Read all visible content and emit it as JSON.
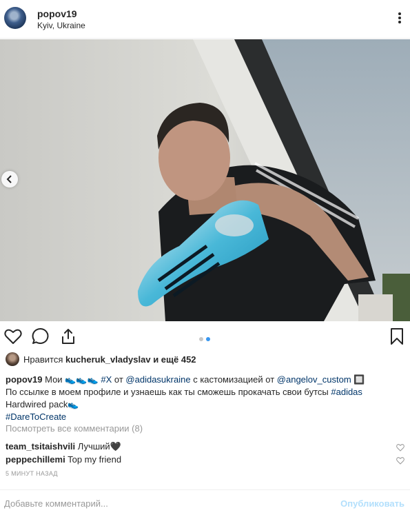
{
  "post": {
    "username": "popov19",
    "location": "Kyiv, Ukraine",
    "more_icon": "more-horizontal-icon"
  },
  "carousel": {
    "total": 2,
    "active_index": 1,
    "colors": {
      "active": "#3897f0",
      "inactive": "#c7c7c7"
    }
  },
  "actions": {
    "like_icon": "heart-outline-icon",
    "comment_icon": "comment-bubble-icon",
    "share_icon": "share-upload-icon",
    "save_icon": "bookmark-icon"
  },
  "likes": {
    "prefix": "Нравится",
    "user": "kucheruk_vladyslav",
    "suffix": "и ещё 452"
  },
  "caption": {
    "author": "popov19",
    "t1": "Мои 👟👟👟",
    "hashtag_x": "#X",
    "t2": "от",
    "mention_adidas": "@adidasukraine",
    "t3": "с кастомизацией от",
    "mention_angelov": "@angelov_custom",
    "t4": "🔲",
    "t5": "По ссылке в моем профиле и узнаешь как ты сможешь прокачать свои бутсы",
    "hashtag_adidas": "#adidas",
    "t6": "Hardwired pack👟",
    "hashtag_dare": "#DareToCreate"
  },
  "comments": {
    "view_all": "Посмотреть все комментарии (8)",
    "items": [
      {
        "user": "team_tsitaishvili",
        "text": "Лучший🖤"
      },
      {
        "user": "peppechillemi",
        "text": "Top my friend"
      }
    ]
  },
  "timestamp": "5 МИНУТ НАЗАД",
  "add_comment": {
    "placeholder": "Добавьте комментарий...",
    "publish_label": "Опубликовать"
  },
  "colors": {
    "link": "#003569",
    "muted": "#999999",
    "publish_disabled": "#b2dffc"
  }
}
